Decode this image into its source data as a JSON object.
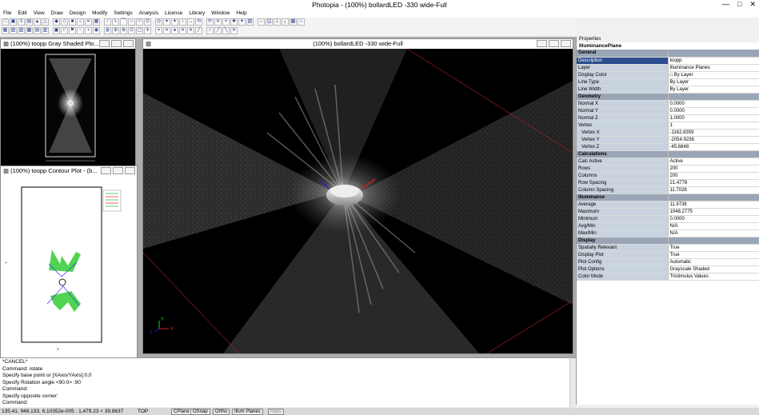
{
  "window": {
    "title": "Photopia - (100%) bollardLED -330 wide-Full"
  },
  "menu": [
    "File",
    "Edit",
    "View",
    "Draw",
    "Design",
    "Modify",
    "Settings",
    "Analysis",
    "License",
    "Library",
    "Window",
    "Help"
  ],
  "toolbar1": [
    "□",
    "▣",
    "≡",
    "▤",
    "▲",
    "△",
    "◆",
    "◇",
    "■",
    "⌂",
    "⌗",
    "▦",
    "∕",
    "∿",
    "⌒",
    "○",
    "☉",
    "⊙",
    "◎",
    "✦",
    "✦",
    "↕",
    "↔",
    "⟲",
    "⟳",
    "✕",
    "⌖",
    "✚",
    "✦",
    "▧",
    "⌵",
    "∐",
    "⊥",
    "┐",
    "▩",
    "⌂"
  ],
  "toolbar2": [
    "▦",
    "▧",
    "▨",
    "▩",
    "▤",
    "▥",
    "▣",
    "⚐",
    "⚑",
    "▫",
    "▪",
    "◉",
    "◍",
    "⊕",
    "⊗",
    "⊙",
    "▢",
    "✛",
    "⌖",
    "⌗",
    "●",
    "✕",
    "✕",
    "╱",
    "○",
    "╱",
    "╲",
    "✕"
  ],
  "windows": {
    "gray": {
      "title": "(100%) toopp Gray Shaded Plo..."
    },
    "contour": {
      "title": "(100%) toopp Contour Plot - (b..."
    },
    "main": {
      "title": "(100%) bollardLED -330 wide-Full"
    }
  },
  "properties": {
    "header": "Properties",
    "object_type": "IlluminancePlane",
    "rows": [
      {
        "type": "cat",
        "key": "General",
        "value": ""
      },
      {
        "type": "sel",
        "key": "Description",
        "value": "toopp"
      },
      {
        "type": "row",
        "key": "Layer",
        "value": "Illuminance Planes"
      },
      {
        "type": "row",
        "key": "Display Color",
        "value": "□  By Layer"
      },
      {
        "type": "row",
        "key": "Line Type",
        "value": "By Layer"
      },
      {
        "type": "row",
        "key": "Line Width",
        "value": "By Layer"
      },
      {
        "type": "cat",
        "key": "Geometry",
        "value": ""
      },
      {
        "type": "row",
        "key": "Normal X",
        "value": "0.0000"
      },
      {
        "type": "row",
        "key": "Normal Y",
        "value": "0.0000"
      },
      {
        "type": "row",
        "key": "Normal Z",
        "value": "1.0000"
      },
      {
        "type": "row",
        "key": "Vertex",
        "value": "1"
      },
      {
        "type": "sub",
        "key": "Vertex X",
        "value": "-1162.8359"
      },
      {
        "type": "sub",
        "key": "Vertex Y",
        "value": "-2054.9236"
      },
      {
        "type": "sub",
        "key": "Vertex Z",
        "value": "-45.6848"
      },
      {
        "type": "cat",
        "key": "Calculations",
        "value": ""
      },
      {
        "type": "row",
        "key": "Calc Active",
        "value": "Active"
      },
      {
        "type": "row",
        "key": "Rows",
        "value": "200"
      },
      {
        "type": "row",
        "key": "Columns",
        "value": "200"
      },
      {
        "type": "row",
        "key": "Row Spacing",
        "value": "21.4778"
      },
      {
        "type": "row",
        "key": "Column Spacing",
        "value": "11.7028"
      },
      {
        "type": "cat",
        "key": "Illuminance",
        "value": ""
      },
      {
        "type": "row",
        "key": "Average",
        "value": "11.9738"
      },
      {
        "type": "row",
        "key": "Maximum",
        "value": "1048.2775"
      },
      {
        "type": "row",
        "key": "Minimum",
        "value": "0.0000"
      },
      {
        "type": "row",
        "key": "Avg/Min",
        "value": "N/A"
      },
      {
        "type": "row",
        "key": "Max/Min",
        "value": "N/A"
      },
      {
        "type": "cat",
        "key": "Display",
        "value": ""
      },
      {
        "type": "row",
        "key": "Spatially Relevant",
        "value": "True"
      },
      {
        "type": "row",
        "key": "Display Plot",
        "value": "True"
      },
      {
        "type": "row",
        "key": "Plot Config",
        "value": "Automatic"
      },
      {
        "type": "row",
        "key": "Plot Options",
        "value": "Grayscale Shaded"
      },
      {
        "type": "row",
        "key": "Color Mode",
        "value": "Tristimulus Values"
      }
    ]
  },
  "command": {
    "lines": [
      "*CANCEL*",
      "Command: rotate",
      "Specify base point or [XAxis/YAxis]:0,0",
      "Specify Rotation angle <90.0> :90",
      "Command:",
      "Specify opposite corner:",
      "Command:"
    ]
  },
  "status": {
    "coords": "135.41, 948.133, 6.10352e-005 : 1,479.23 < 39.8637",
    "view": "TOP",
    "toggles": [
      "CPlane",
      "OSnap",
      "Ortho",
      "Illum Planes",
      "Rays"
    ]
  },
  "colors": {
    "selected_row": "#2a4d8e",
    "category_row": "#9aa6b5",
    "key_cell": "#c9d3e0"
  }
}
